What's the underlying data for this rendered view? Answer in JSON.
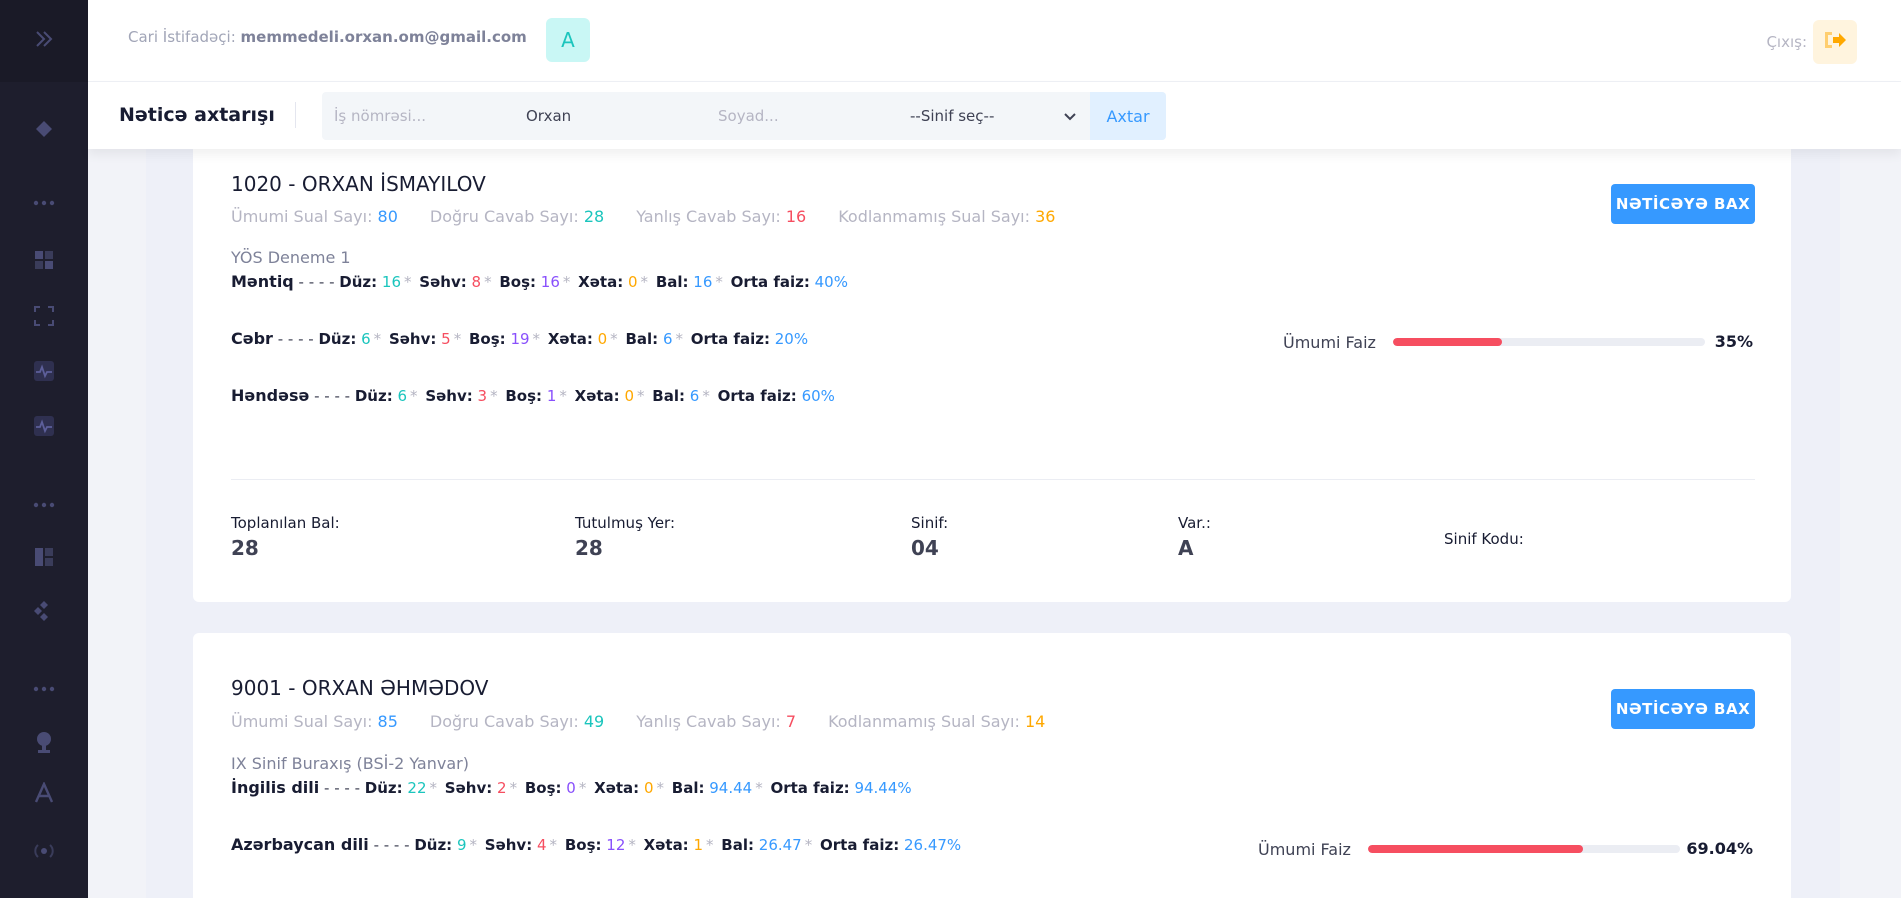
{
  "header": {
    "user_label": "Cari İstifadəçi:",
    "user_email": "memmedeli.orxan.om@gmail.com",
    "avatar_letter": "A",
    "logout_label": "Çıxış:"
  },
  "subheader": {
    "title": "Nəticə axtarışı",
    "search_number_placeholder": "İş nömrəsi...",
    "search_name_value": "Orxan",
    "search_surname_placeholder": "Soyad...",
    "class_select_value": "--Sinif seç--",
    "search_button": "Axtar"
  },
  "labels": {
    "total_q": "Ümumi Sual Sayı:",
    "correct": "Doğru Cavab Sayı:",
    "wrong": "Yanlış Cavab Sayı:",
    "uncoded": "Kodlanmamış Sual Sayı:",
    "view_result": "NƏTİCƏYƏ BAX",
    "duz": "Düz:",
    "sehv": "Səhv:",
    "bos": "Boş:",
    "xeta": "Xəta:",
    "bal": "Bal:",
    "orta_faiz": "Orta faiz:",
    "dash": "- - - -",
    "star": "*",
    "overall_percent": "Ümumi Faiz",
    "collected_score": "Toplanılan Bal:",
    "rank": "Tutulmuş Yer:",
    "class": "Sinif:",
    "variant": "Var.:",
    "class_code": "Sinif Kodu:"
  },
  "results": [
    {
      "title": "1020 - ORXAN İSMAYILOV",
      "total_q": "80",
      "correct": "28",
      "wrong": "16",
      "uncoded": "36",
      "exam": "YÖS Deneme 1",
      "subjects": [
        {
          "name": "Məntiq",
          "duz": "16",
          "sehv": "8",
          "bos": "16",
          "xeta": "0",
          "bal": "16",
          "faiz": "40%"
        },
        {
          "name": "Cəbr",
          "duz": "6",
          "sehv": "5",
          "bos": "19",
          "xeta": "0",
          "bal": "6",
          "faiz": "20%"
        },
        {
          "name": "Həndəsə",
          "duz": "6",
          "sehv": "3",
          "bos": "1",
          "xeta": "0",
          "bal": "6",
          "faiz": "60%"
        }
      ],
      "overall": "35%",
      "overall_fraction": 0.35,
      "collected_score": "28",
      "rank": "28",
      "class": "04",
      "variant": "A",
      "class_code": ""
    },
    {
      "title": "9001 - ORXAN ƏHMƏDOV",
      "total_q": "85",
      "correct": "49",
      "wrong": "7",
      "uncoded": "14",
      "exam": "IX Sinif Buraxış (BSİ-2 Yanvar)",
      "subjects": [
        {
          "name": "İngilis dili",
          "duz": "22",
          "sehv": "2",
          "bos": "0",
          "xeta": "0",
          "bal": "94.44",
          "faiz": "94.44%"
        },
        {
          "name": "Azərbaycan dili",
          "duz": "9",
          "sehv": "4",
          "bos": "12",
          "xeta": "1",
          "bal": "26.47",
          "faiz": "26.47%"
        }
      ],
      "overall": "69.04%",
      "overall_fraction": 0.6904
    }
  ]
}
